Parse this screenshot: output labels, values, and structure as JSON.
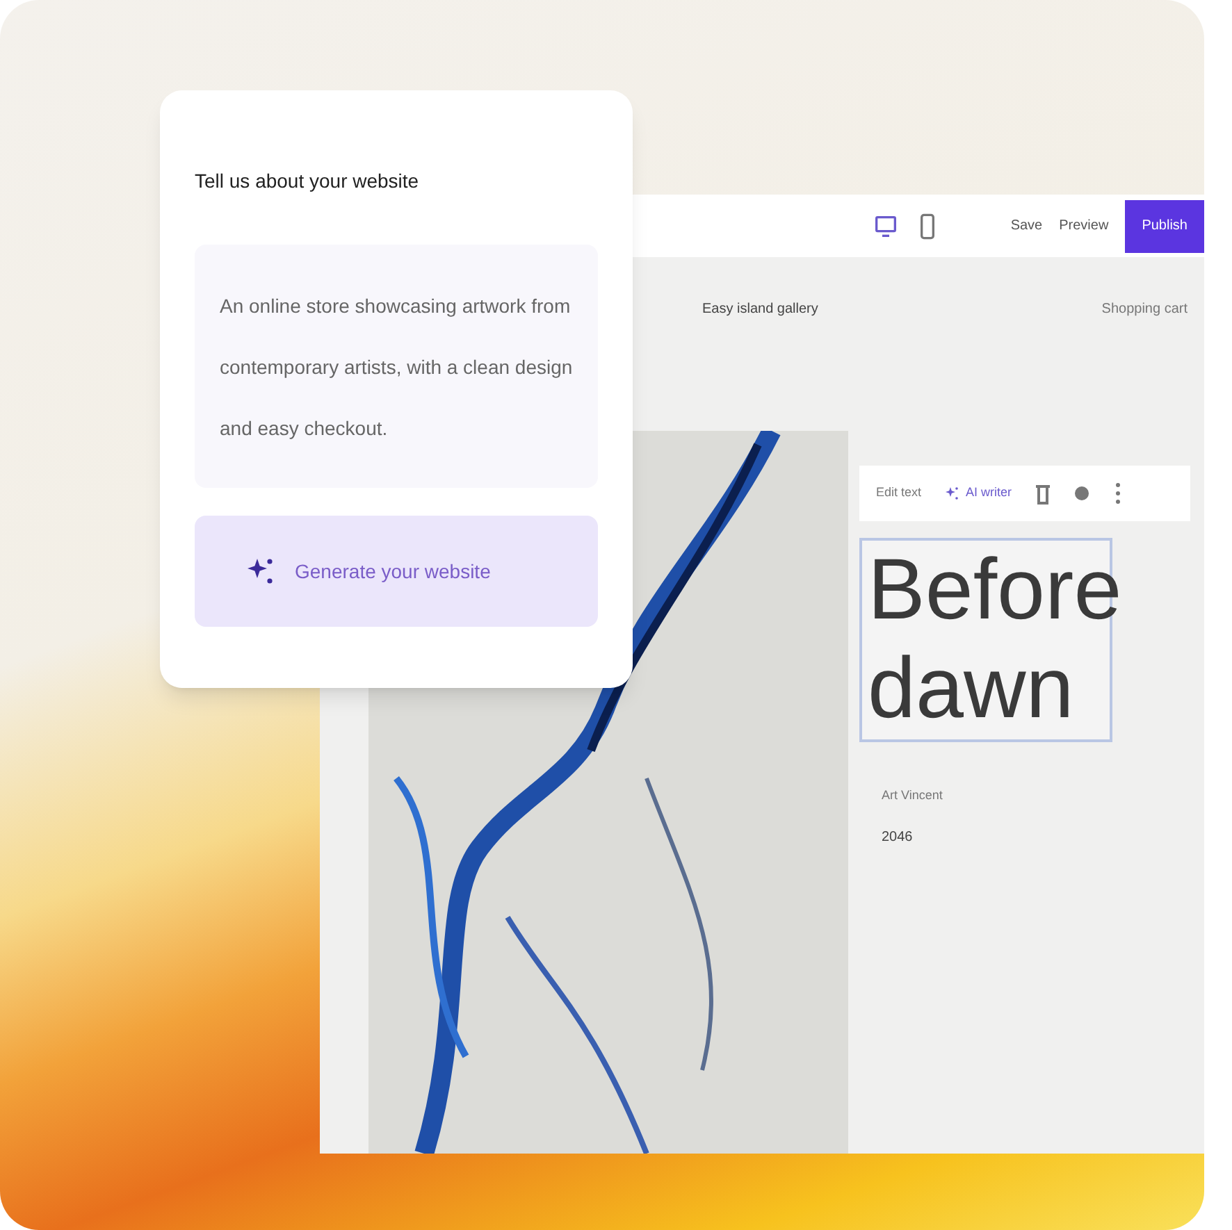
{
  "prompt_card": {
    "title": "Tell us about your website",
    "prompt": "An online store showcasing artwork from contemporary artists, with a clean design and easy checkout.",
    "generate_button": "Generate your website"
  },
  "editor": {
    "toolbar": {
      "save": "Save",
      "preview": "Preview",
      "publish": "Publish"
    },
    "site_nav": {
      "site_name": "Easy island gallery",
      "cart": "Shopping cart"
    },
    "text_toolbar": {
      "edit": "Edit text",
      "ai_writer": "AI writer"
    },
    "artwork": {
      "title": "Before dawn",
      "artist": "Art Vincent",
      "year": "2046"
    }
  }
}
